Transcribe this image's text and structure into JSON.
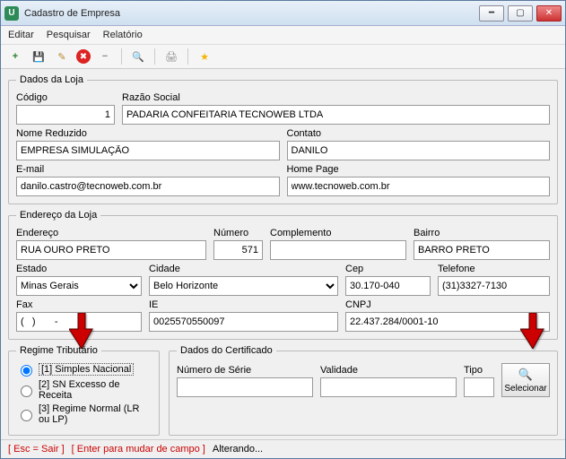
{
  "window": {
    "title": "Cadastro de Empresa",
    "app_icon_letter": "U"
  },
  "menu": {
    "editar": "Editar",
    "pesquisar": "Pesquisar",
    "relatorio": "Relatório"
  },
  "icons": {
    "add": "+",
    "save": "💾",
    "edit": "✎",
    "delete": "✖",
    "minus": "−",
    "search": "🔍",
    "print": "🖨",
    "star": "★"
  },
  "dados_loja": {
    "legend": "Dados da Loja",
    "codigo_label": "Código",
    "codigo": "1",
    "razao_label": "Razão Social",
    "razao": "PADARIA CONFEITARIA TECNOWEB LTDA",
    "nome_red_label": "Nome Reduzido",
    "nome_red": "EMPRESA SIMULAÇÃO",
    "contato_label": "Contato",
    "contato": "DANILO",
    "email_label": "E-mail",
    "email": "danilo.castro@tecnoweb.com.br",
    "homepage_label": "Home Page",
    "homepage": "www.tecnoweb.com.br"
  },
  "endereco": {
    "legend": "Endereço da Loja",
    "endereco_label": "Endereço",
    "endereco": "RUA OURO PRETO",
    "numero_label": "Número",
    "numero": "571",
    "comp_label": "Complemento",
    "comp": "",
    "bairro_label": "Bairro",
    "bairro": "BARRO PRETO",
    "estado_label": "Estado",
    "estado": "Minas Gerais",
    "cidade_label": "Cidade",
    "cidade": "Belo Horizonte",
    "cep_label": "Cep",
    "cep": "30.170-040",
    "telefone_label": "Telefone",
    "telefone": "(31)3327-7130",
    "fax_label": "Fax",
    "fax": "(   )       -",
    "ie_label": "IE",
    "ie": "0025570550097",
    "cnpj_label": "CNPJ",
    "cnpj": "22.437.284/0001-10"
  },
  "regime": {
    "legend": "Regime Tributário",
    "opt1": "[1] Simples Nacional",
    "opt2": "[2] SN Excesso de Receita",
    "opt3": "[3] Regime Normal (LR ou LP)",
    "selected": 1
  },
  "certificado": {
    "legend": "Dados do Certificado",
    "numero_label": "Número de Série",
    "numero": "",
    "validade_label": "Validade",
    "validade": "",
    "tipo_label": "Tipo",
    "tipo": "",
    "selecionar": "Selecionar",
    "search_icon": "🔍"
  },
  "status": {
    "esc": "[ Esc = Sair ]",
    "enter": "[ Enter para mudar de campo ]",
    "mode": "Alterando..."
  }
}
